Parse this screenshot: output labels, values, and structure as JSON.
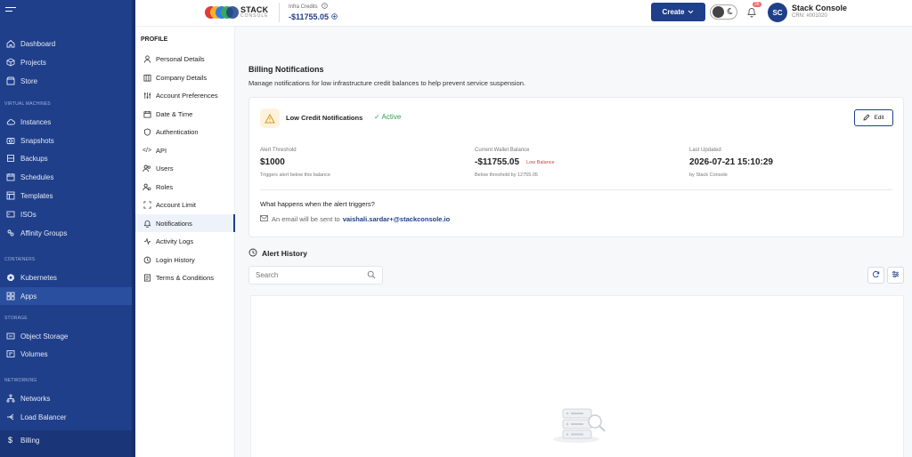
{
  "nav": {
    "items": [
      {
        "label": "Dashboard",
        "icon": "home-icon"
      },
      {
        "label": "Projects",
        "icon": "box-icon"
      },
      {
        "label": "Store",
        "icon": "store-icon"
      },
      {
        "label": "Instances",
        "icon": "cloud-icon"
      },
      {
        "label": "Snapshots",
        "icon": "snapshot-icon"
      },
      {
        "label": "Backups",
        "icon": "backup-icon"
      },
      {
        "label": "Schedules",
        "icon": "calendar-icon"
      },
      {
        "label": "Templates",
        "icon": "template-icon"
      },
      {
        "label": "ISOs",
        "icon": "disk-icon"
      },
      {
        "label": "Affinity Groups",
        "icon": "group-icon"
      },
      {
        "label": "Kubernetes",
        "icon": "kubernetes-icon"
      },
      {
        "label": "Apps",
        "icon": "apps-icon"
      },
      {
        "label": "Object Storage",
        "icon": "object-storage-icon"
      },
      {
        "label": "Volumes",
        "icon": "volume-icon"
      },
      {
        "label": "Networks",
        "icon": "network-icon"
      },
      {
        "label": "Load Balancer",
        "icon": "load-balancer-icon"
      },
      {
        "label": "Billing",
        "icon": "dollar-icon"
      }
    ],
    "sections": {
      "virtual_machines": "VIRTUAL MACHINES",
      "containers": "CONTAINERS",
      "storage": "STORAGE",
      "networking": "NETWORKING"
    }
  },
  "topbar": {
    "brand_name": "STACK",
    "brand_sub": "CONSOLE",
    "credits_label": "Infra Credits",
    "credits_value": "-$11755.05",
    "create_label": "Create",
    "notification_count": "26",
    "avatar_initials": "SC",
    "account_name": "Stack Console",
    "account_crn": "CRN: #001020"
  },
  "profile": {
    "heading": "PROFILE",
    "items": [
      {
        "label": "Personal Details",
        "icon": "user-icon"
      },
      {
        "label": "Company Details",
        "icon": "building-icon"
      },
      {
        "label": "Account Preferences",
        "icon": "sliders-icon"
      },
      {
        "label": "Date & Time",
        "icon": "calendar-icon"
      },
      {
        "label": "Authentication",
        "icon": "shield-icon"
      },
      {
        "label": "API",
        "icon": "code-icon"
      },
      {
        "label": "Users",
        "icon": "users-icon"
      },
      {
        "label": "Roles",
        "icon": "roles-icon"
      },
      {
        "label": "Account Limit",
        "icon": "limit-icon"
      },
      {
        "label": "Notifications",
        "icon": "bell-icon"
      },
      {
        "label": "Activity Logs",
        "icon": "activity-icon"
      },
      {
        "label": "Login History",
        "icon": "history-icon"
      },
      {
        "label": "Terms & Conditions",
        "icon": "document-icon"
      }
    ]
  },
  "main": {
    "title": "Billing Notifications",
    "subtitle": "Manage notifications for low infrastructure credit balances to help prevent service suspension.",
    "card": {
      "title": "Low Credit Notifications",
      "status": "Active",
      "edit_label": "Edit",
      "threshold_label": "Alert Threshold",
      "threshold_value": "$1000",
      "threshold_sub": "Triggers alert below this balance",
      "wallet_label": "Current Wallet Balance",
      "wallet_value": "-$11755.05",
      "wallet_tag": "Low Balance",
      "wallet_sub": "Below threshold by 12755.05",
      "updated_label": "Last Updated",
      "updated_value": "2026-07-21 15:10:29",
      "updated_sub": "by Stack Console",
      "question": "What happens when the alert triggers?",
      "email_prefix": "An email will be sent to",
      "email": "vaishali.sardar+@stackconsole.io"
    },
    "history_title": "Alert History",
    "search_placeholder": "Search"
  },
  "colors": {
    "nav_bg": "#1f3f8a",
    "accent": "#1f3f8a",
    "success": "#2e9e4e",
    "danger": "#d24141"
  }
}
